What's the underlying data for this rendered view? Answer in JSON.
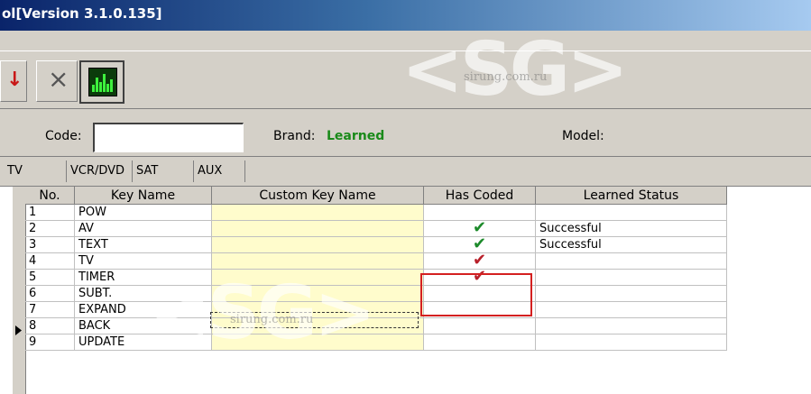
{
  "window": {
    "title": "ol[Version 3.1.0.135]"
  },
  "toolbar": {
    "arrow_icon": "red-arrow-icon",
    "close_glyph": "×",
    "learn_icon": "waveform-icon"
  },
  "info": {
    "code_label": "Code:",
    "code_value": "",
    "brand_label": "Brand:",
    "brand_value": "Learned",
    "model_label": "Model:",
    "model_value": "",
    "brand_color": "#1a8a1a"
  },
  "tabs": [
    {
      "label": "TV"
    },
    {
      "label": "VCR/DVD"
    },
    {
      "label": "SAT"
    },
    {
      "label": "AUX"
    }
  ],
  "table": {
    "headers": [
      "No.",
      "Key Name",
      "Custom Key Name",
      "Has Coded",
      "Learned Status"
    ],
    "rows": [
      {
        "no": "1",
        "key": "POW",
        "custom": "",
        "coded": "",
        "status": ""
      },
      {
        "no": "2",
        "key": "AV",
        "custom": "",
        "coded": "✔",
        "status": "Successful"
      },
      {
        "no": "3",
        "key": "TEXT",
        "custom": "",
        "coded": "✔",
        "status": "Successful"
      },
      {
        "no": "4",
        "key": "TV",
        "custom": "",
        "coded": "✔",
        "status": ""
      },
      {
        "no": "5",
        "key": "TIMER",
        "custom": "",
        "coded": "✔",
        "status": ""
      },
      {
        "no": "6",
        "key": "SUBT.",
        "custom": "",
        "coded": "",
        "status": ""
      },
      {
        "no": "7",
        "key": "EXPAND",
        "custom": "",
        "coded": "",
        "status": ""
      },
      {
        "no": "8",
        "key": "BACK",
        "custom": "",
        "coded": "",
        "status": ""
      },
      {
        "no": "9",
        "key": "UPDATE",
        "custom": "",
        "coded": "",
        "status": ""
      }
    ]
  },
  "watermark": {
    "logo": "<SG>",
    "site": "sirung.com.ru"
  },
  "colors": {
    "check_green": "#1c8a2a",
    "check_red": "#b8202a",
    "highlight": "#d42020",
    "custom_bg": "#fffccc"
  }
}
